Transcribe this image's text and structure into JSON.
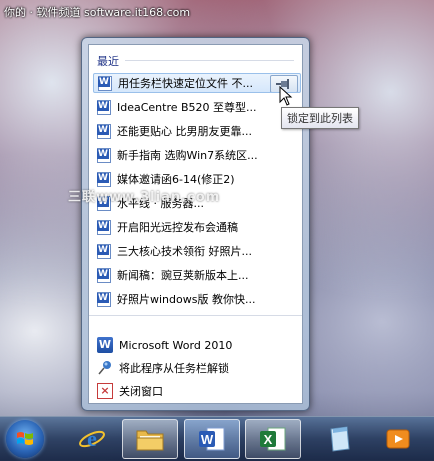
{
  "watermark": {
    "top": "你的 · 软件频道 software.it168.com",
    "middle": "三联www.3lian.com"
  },
  "jumplist": {
    "recent_header": "最近",
    "items": [
      {
        "label": "用任务栏快速定位文件 不..."
      },
      {
        "label": "IdeaCentre B520 至尊型..."
      },
      {
        "label": "还能更贴心 比男朋友更靠..."
      },
      {
        "label": "新手指南 选购Win7系统区..."
      },
      {
        "label": "媒体邀请函6-14(修正2)"
      },
      {
        "label": "水平线 · 服务器..."
      },
      {
        "label": "开启阳光远控发布会通稿"
      },
      {
        "label": "三大核心技术领衔 好照片..."
      },
      {
        "label": "新闻稿：豌豆荚新版本上..."
      },
      {
        "label": "好照片windows版 教你快..."
      }
    ],
    "pin_tooltip": "锁定到此列表",
    "tasks": [
      {
        "label": "Microsoft Word 2010",
        "icon": "word-icon"
      },
      {
        "label": "将此程序从任务栏解锁",
        "icon": "unpin-icon"
      },
      {
        "label": "关闭窗口",
        "icon": "close-window-icon"
      }
    ]
  },
  "taskbar": {
    "buttons": [
      {
        "name": "start",
        "icon": "windows-logo-icon"
      },
      {
        "name": "internet-explorer",
        "icon": "ie-icon"
      },
      {
        "name": "windows-explorer",
        "icon": "folder-icon"
      },
      {
        "name": "microsoft-word",
        "icon": "word-icon"
      },
      {
        "name": "microsoft-excel",
        "icon": "excel-icon"
      },
      {
        "name": "notepad",
        "icon": "notepad-icon"
      },
      {
        "name": "media-player",
        "icon": "media-player-icon"
      }
    ],
    "word_glyph": "W",
    "excel_glyph": "X",
    "ie_glyph": "e"
  },
  "colors": {
    "header_blue": "#1e3287",
    "word_blue": "#2b5bb5",
    "excel_green": "#1f7a3a"
  }
}
